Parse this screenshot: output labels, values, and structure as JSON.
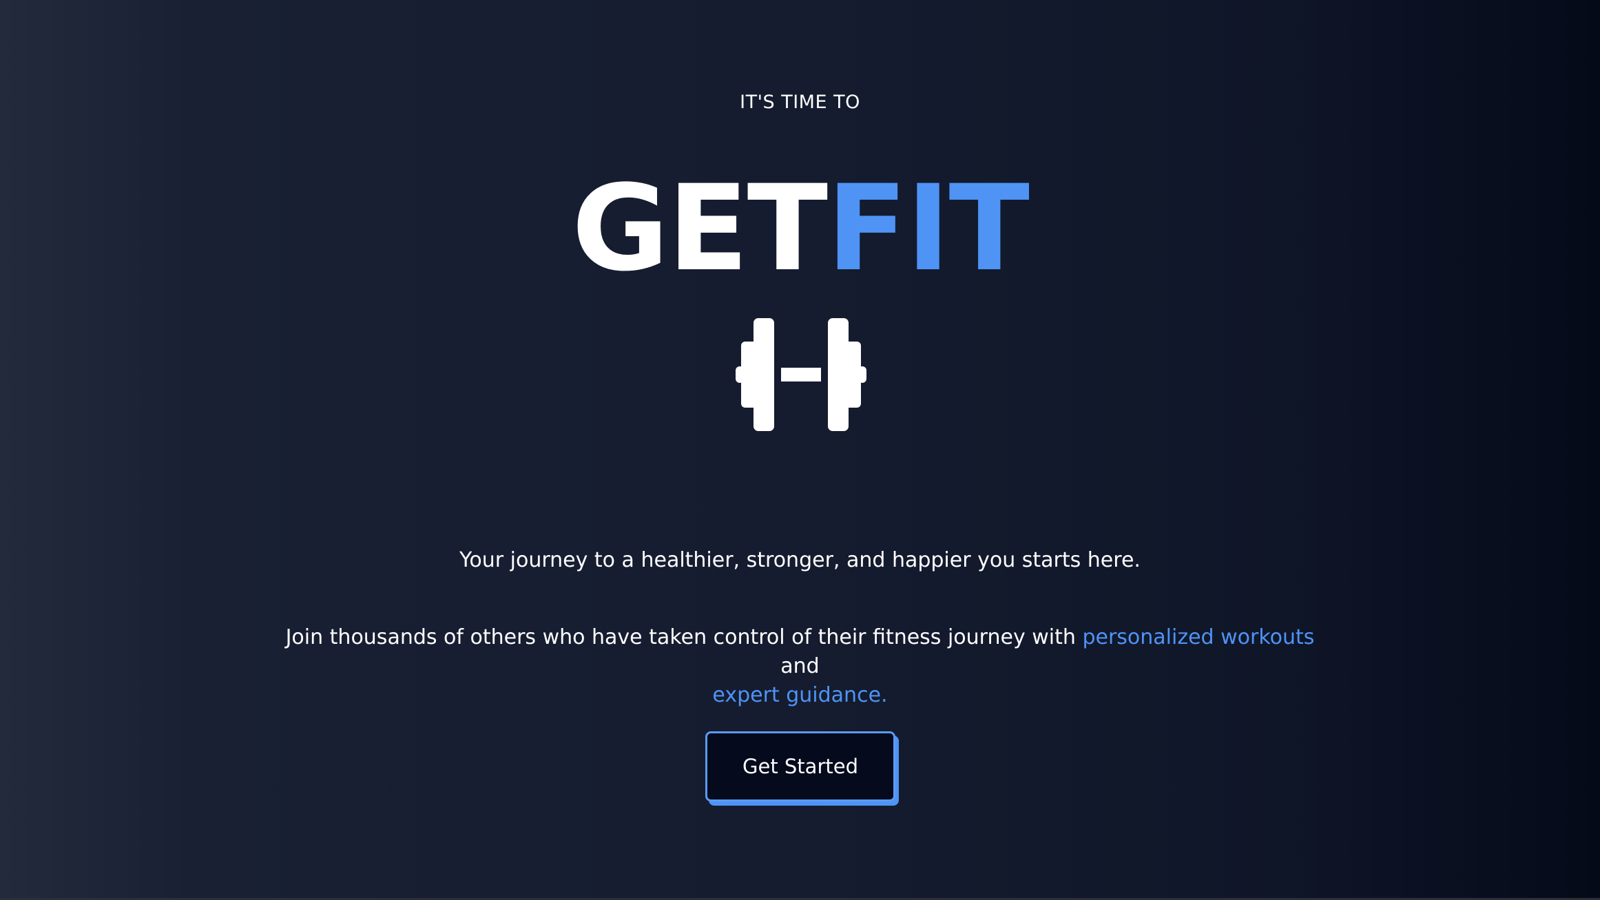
{
  "hero": {
    "eyebrow": "IT'S TIME TO",
    "title_part1": "GET",
    "title_part2": "FIT",
    "icon": "dumbbell-icon",
    "tagline": "Your journey to a healthier, stronger, and happier you starts here.",
    "desc_prefix": "Join thousands of others who have taken control of their fitness journey with ",
    "desc_highlight1": "personalized workouts",
    "desc_mid": " and ",
    "desc_highlight2": "expert guidance.",
    "cta_label": "Get Started"
  },
  "colors": {
    "accent": "#4f93f5",
    "background_dark": "#050a19",
    "background_light": "#222a3b",
    "text": "#ffffff"
  }
}
